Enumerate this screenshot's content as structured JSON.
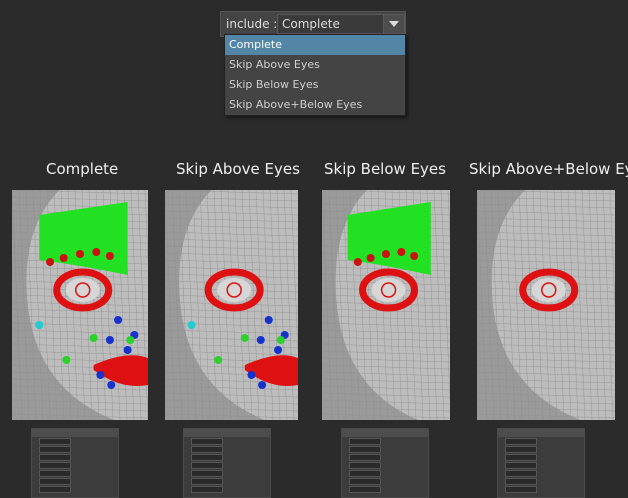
{
  "include": {
    "label": "include :",
    "selected": "Complete",
    "options": [
      "Complete",
      "Skip Above Eyes",
      "Skip Below Eyes",
      "Skip Above+Below Eyes"
    ]
  },
  "panels": [
    {
      "title": "Complete",
      "skip_above": false,
      "skip_below": false
    },
    {
      "title": "Skip Above Eyes",
      "skip_above": true,
      "skip_below": false
    },
    {
      "title": "Skip Below Eyes",
      "skip_above": false,
      "skip_below": true
    },
    {
      "title": "Skip Above+Below Eyes",
      "skip_above": true,
      "skip_below": true
    }
  ],
  "colors": {
    "background": "#2b2b2b",
    "menu_highlight": "#5285a6",
    "forehead": "#22e022",
    "lips": "#dd1111",
    "eye_ring": "#dd1111",
    "dot_red": "#cc1111",
    "dot_green": "#2ad22a",
    "dot_blue": "#1533cc",
    "dot_cyan": "#22cccc"
  }
}
